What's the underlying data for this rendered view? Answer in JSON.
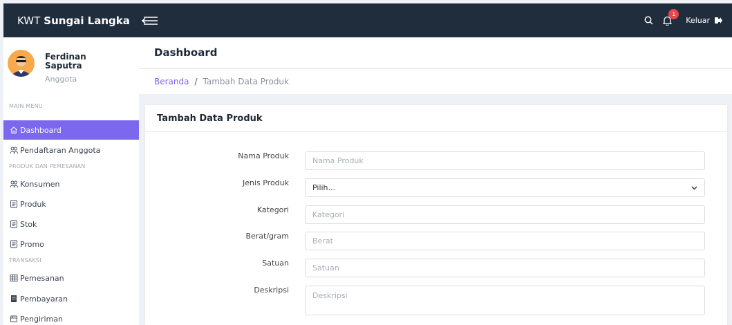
{
  "header": {
    "brand_prefix": "KWT",
    "brand_name": "Sungai Langka",
    "notification_count": "1",
    "logout_label": "Keluar"
  },
  "sidebar": {
    "user_name": "Ferdinan Saputra",
    "user_role": "Anggota",
    "section_main": "MAIN MENU",
    "section_products": "PRODUK DAN PEMESANAN",
    "section_transactions": "TRANSAKSI",
    "items": [
      {
        "label": "Dashboard",
        "icon": "home-icon",
        "active": true
      },
      {
        "label": "Pendaftaran Anggota",
        "icon": "users-icon"
      },
      {
        "label": "Konsumen",
        "icon": "users-icon"
      },
      {
        "label": "Produk",
        "icon": "list-icon"
      },
      {
        "label": "Stok",
        "icon": "list-icon"
      },
      {
        "label": "Promo",
        "icon": "list-icon"
      },
      {
        "label": "Pemesanan",
        "icon": "table-icon"
      },
      {
        "label": "Pembayaran",
        "icon": "receipt-icon"
      },
      {
        "label": "Pengiriman",
        "icon": "box-icon"
      }
    ]
  },
  "page": {
    "title": "Dashboard",
    "breadcrumb_home": "Beranda",
    "breadcrumb_current": "Tambah Data Produk"
  },
  "form": {
    "title": "Tambah Data Produk",
    "fields": [
      {
        "label": "Nama Produk",
        "placeholder": "Nama Produk"
      },
      {
        "label": "Jenis Produk",
        "selected": "Pilih..."
      },
      {
        "label": "Kategori",
        "placeholder": "Kategori"
      },
      {
        "label": "Berat/gram",
        "placeholder": "Berat"
      },
      {
        "label": "Satuan",
        "placeholder": "Satuan"
      },
      {
        "label": "Deskripsi",
        "placeholder": "Deskripsi"
      }
    ]
  },
  "colors": {
    "topbar": "#1f2d3d",
    "accent": "#7b68ee",
    "badge": "#e8454a"
  }
}
